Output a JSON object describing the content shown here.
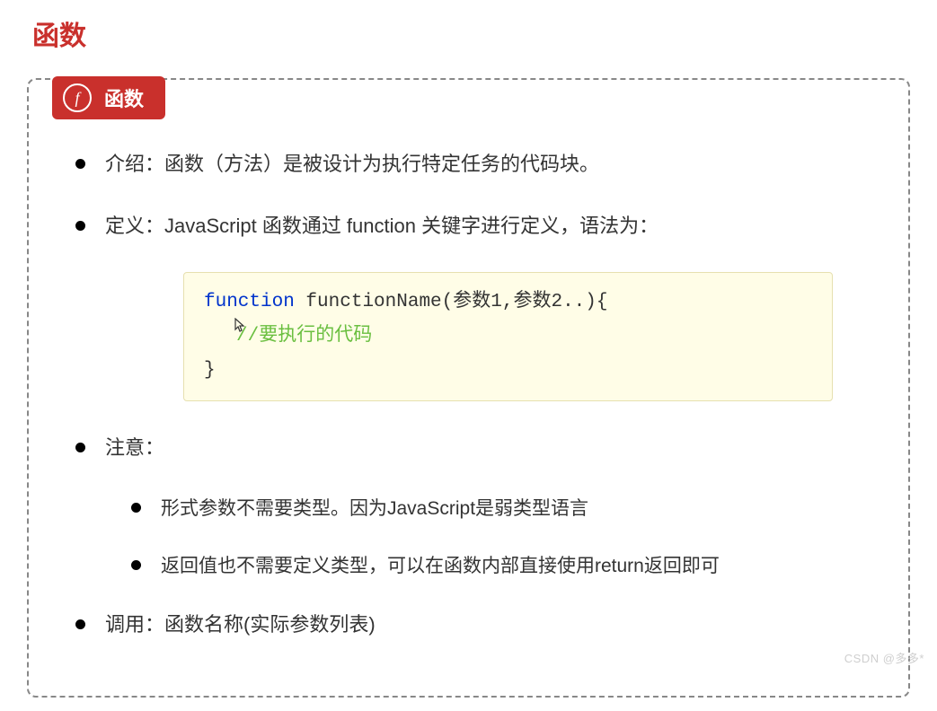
{
  "title": "函数",
  "badge": {
    "icon_letter": "f",
    "label": "函数"
  },
  "items": {
    "intro": "介绍：函数（方法）是被设计为执行特定任务的代码块。",
    "define": "定义：JavaScript 函数通过 function 关键字进行定义，语法为：",
    "note": "注意：",
    "sub1": "形式参数不需要类型。因为JavaScript是弱类型语言",
    "sub2": "返回值也不需要定义类型，可以在函数内部直接使用return返回即可",
    "call": "调用：函数名称(实际参数列表)"
  },
  "code": {
    "line1_kw": "function",
    "line1_rest": " functionName(参数1,参数2..){",
    "line2_comment": "//要执行的代码",
    "line3": "}"
  },
  "watermark": "CSDN @多多*"
}
